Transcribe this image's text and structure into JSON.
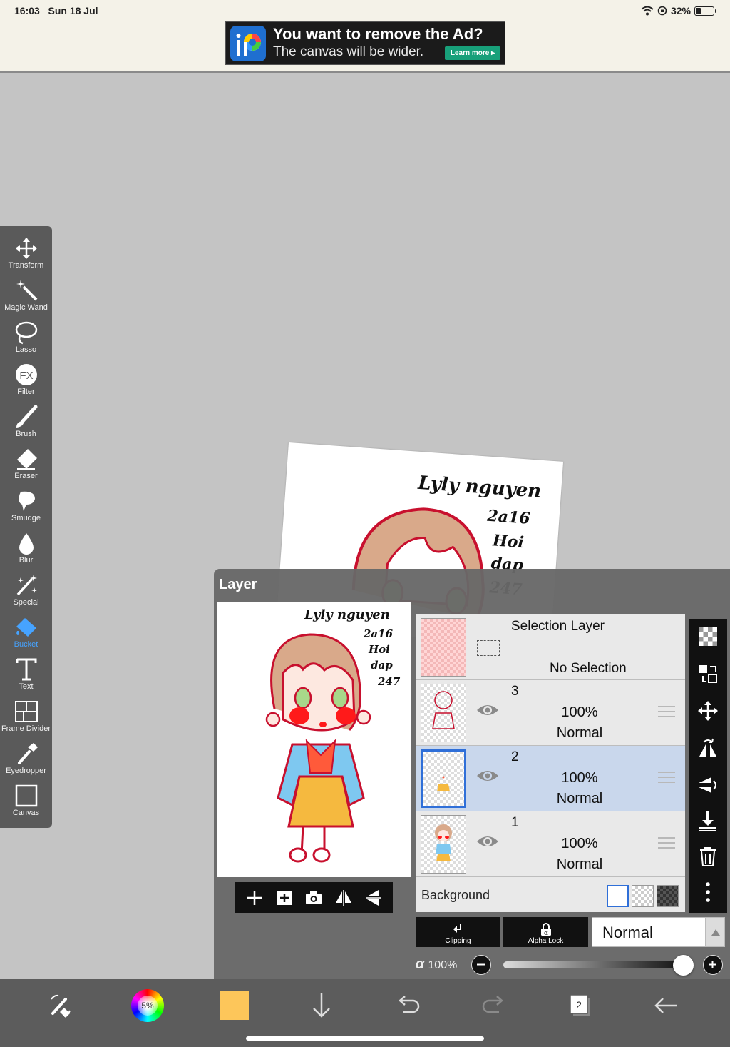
{
  "status_bar": {
    "time": "16:03",
    "date": "Sun 18 Jul",
    "battery": "32%"
  },
  "ad": {
    "title": "You want to remove the Ad?",
    "subtitle": "The canvas will be wider.",
    "button": "Learn more ▸"
  },
  "toolbar": {
    "active_tool": "Bucket",
    "accent_color": "#46a3ff",
    "items": [
      {
        "label": "Transform",
        "icon": "move-arrows-icon"
      },
      {
        "label": "Magic Wand",
        "icon": "magic-wand-icon"
      },
      {
        "label": "Lasso",
        "icon": "lasso-icon"
      },
      {
        "label": "Filter",
        "icon": "fx-icon"
      },
      {
        "label": "Brush",
        "icon": "brush-icon"
      },
      {
        "label": "Eraser",
        "icon": "eraser-icon"
      },
      {
        "label": "Smudge",
        "icon": "smudge-icon"
      },
      {
        "label": "Blur",
        "icon": "blur-drop-icon"
      },
      {
        "label": "Special",
        "icon": "special-wand-icon"
      },
      {
        "label": "Bucket",
        "icon": "bucket-icon"
      },
      {
        "label": "Text",
        "icon": "text-icon"
      },
      {
        "label": "Frame Divider",
        "icon": "frame-divider-icon"
      },
      {
        "label": "Eyedropper",
        "icon": "eyedropper-icon"
      },
      {
        "label": "Canvas",
        "icon": "canvas-icon"
      }
    ]
  },
  "artwork": {
    "signature_lines": [
      "Lyly nguyen",
      "2a16",
      "Hoi",
      "dap",
      "247"
    ],
    "palette": {
      "line": "#c8102e",
      "hair": "#d9a98a",
      "shirt": "#7ec8f0",
      "skirt": "#f5b93f",
      "cheeks": "#ff1a1a",
      "eyes": "#a8d88a"
    }
  },
  "layer_panel": {
    "title": "Layer",
    "selection_layer": {
      "name": "Selection Layer",
      "state": "No Selection"
    },
    "layers": [
      {
        "number": "3",
        "opacity": "100%",
        "mode": "Normal",
        "selected": false
      },
      {
        "number": "2",
        "opacity": "100%",
        "mode": "Normal",
        "selected": true
      },
      {
        "number": "1",
        "opacity": "100%",
        "mode": "Normal",
        "selected": false
      }
    ],
    "background_label": "Background",
    "clipping_label": "Clipping",
    "alpha_lock_label": "Alpha Lock",
    "blend_mode": "Normal",
    "alpha_symbol": "α",
    "alpha_value": "100%",
    "alpha_fraction": 1.0,
    "selection_color": "#2f6fd8"
  },
  "bottom_bar": {
    "color_wheel_label": "5%",
    "current_color": "#fdc65a",
    "layer_count": "2"
  }
}
